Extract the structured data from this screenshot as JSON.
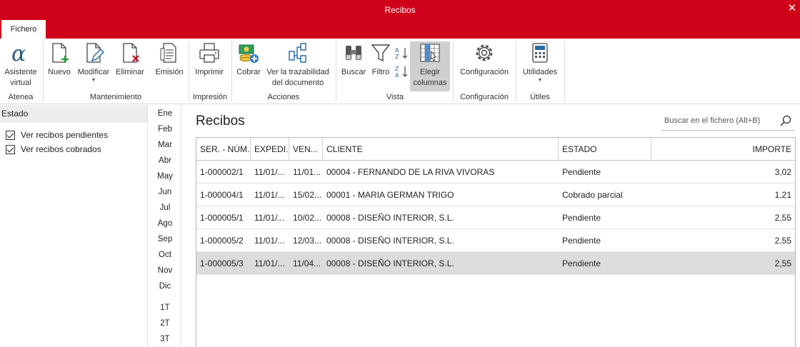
{
  "window": {
    "title": "Recibos",
    "close_glyph": "✕"
  },
  "tabs": {
    "active": "Fichero"
  },
  "ribbon": {
    "buttons": {
      "asistente": [
        "Asistente",
        "virtual"
      ],
      "nuevo": "Nuevo",
      "modificar": "Modificar",
      "eliminar": "Eliminar",
      "emision": "Emisión",
      "imprimir": "Imprimir",
      "cobrar": "Cobrar",
      "trazabilidad": [
        "Ver la trazabilidad",
        "del documento"
      ],
      "buscar": "Buscar",
      "filtro": "Filtro",
      "elegir": [
        "Elegir",
        "columnas"
      ],
      "configuracion": "Configuración",
      "utilidades": "Utilidades"
    },
    "groups": {
      "atenea": "Atenea",
      "mantenimiento": "Mantenimiento",
      "impresion": "Impresión",
      "acciones": "Acciones",
      "vista": "Vista",
      "configuracion": "Configuración",
      "utiles": "Útiles"
    },
    "accent": "#d0021b"
  },
  "left_panel": {
    "header": "Estado",
    "checks": [
      {
        "label": "Ver recibos pendientes",
        "checked": true
      },
      {
        "label": "Ver recibos cobrados",
        "checked": true
      }
    ]
  },
  "periods": [
    "Ene",
    "Feb",
    "Mar",
    "Abr",
    "May",
    "Jun",
    "Jul",
    "Ago",
    "Sep",
    "Oct",
    "Nov",
    "Dic",
    "1T",
    "2T",
    "3T"
  ],
  "main": {
    "title": "Recibos",
    "search_placeholder": "Buscar en el fichero (Alt+B)"
  },
  "table": {
    "columns": [
      "SER. - NÚM.",
      "EXPEDI...",
      "VEN...",
      "CLIENTE",
      "ESTADO",
      "IMPORTE"
    ],
    "rows": [
      [
        "1-000002/1",
        "11/01/...",
        "11/01...",
        "00004 - FERNANDO DE LA RIVA VIVORAS",
        "Pendiente",
        "3,02"
      ],
      [
        "1-000004/1",
        "11/01/...",
        "15/02...",
        "00001 - MARIA GERMAN TRIGO",
        "Cobrado parcial",
        "1,21"
      ],
      [
        "1-000005/1",
        "11/01/...",
        "10/02...",
        "00008 - DISEÑO INTERIOR, S.L.",
        "Pendiente",
        "2,55"
      ],
      [
        "1-000005/2",
        "11/01/...",
        "12/03...",
        "00008 - DISEÑO INTERIOR, S.L.",
        "Pendiente",
        "2,55"
      ],
      [
        "1-000005/3",
        "11/01/...",
        "11/04...",
        "00008 - DISEÑO INTERIOR, S.L.",
        "Pendiente",
        "2,55"
      ]
    ],
    "selected_row_index": 4
  }
}
